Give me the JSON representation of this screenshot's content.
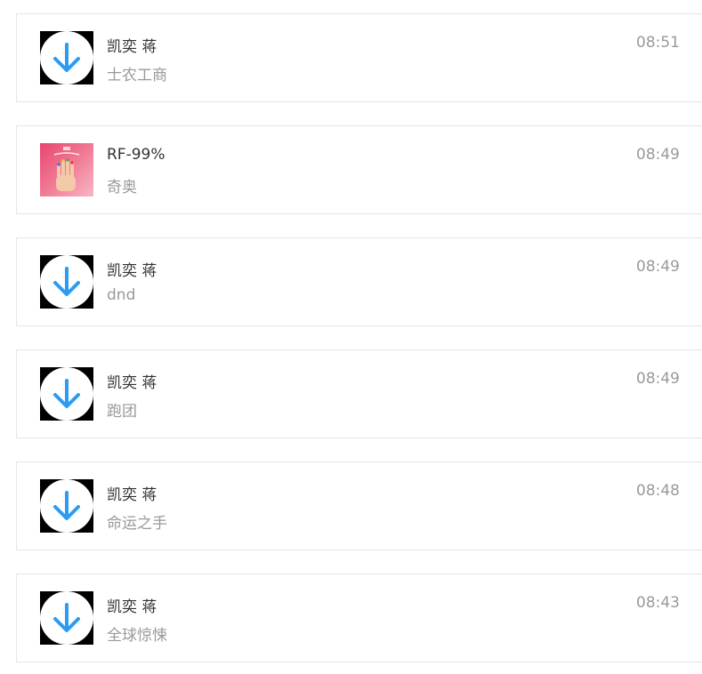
{
  "colors": {
    "download_arrow": "#2b9cf2",
    "name_text": "#333333",
    "secondary_text": "#999999",
    "border": "#e6e6e6"
  },
  "items": [
    {
      "name": "凯奕 蒋",
      "subtitle": "士农工商",
      "time": "08:51",
      "avatar_icon": "download-arrow-icon"
    },
    {
      "name": "RF-99%",
      "subtitle": "奇奥",
      "time": "08:49",
      "avatar_icon": "album-cover-image"
    },
    {
      "name": "凯奕 蒋",
      "subtitle": "dnd",
      "time": "08:49",
      "avatar_icon": "download-arrow-icon"
    },
    {
      "name": "凯奕 蒋",
      "subtitle": "跑团",
      "time": "08:49",
      "avatar_icon": "download-arrow-icon"
    },
    {
      "name": "凯奕 蒋",
      "subtitle": "命运之手",
      "time": "08:48",
      "avatar_icon": "download-arrow-icon"
    },
    {
      "name": "凯奕 蒋",
      "subtitle": "全球惊悚",
      "time": "08:43",
      "avatar_icon": "download-arrow-icon"
    }
  ]
}
